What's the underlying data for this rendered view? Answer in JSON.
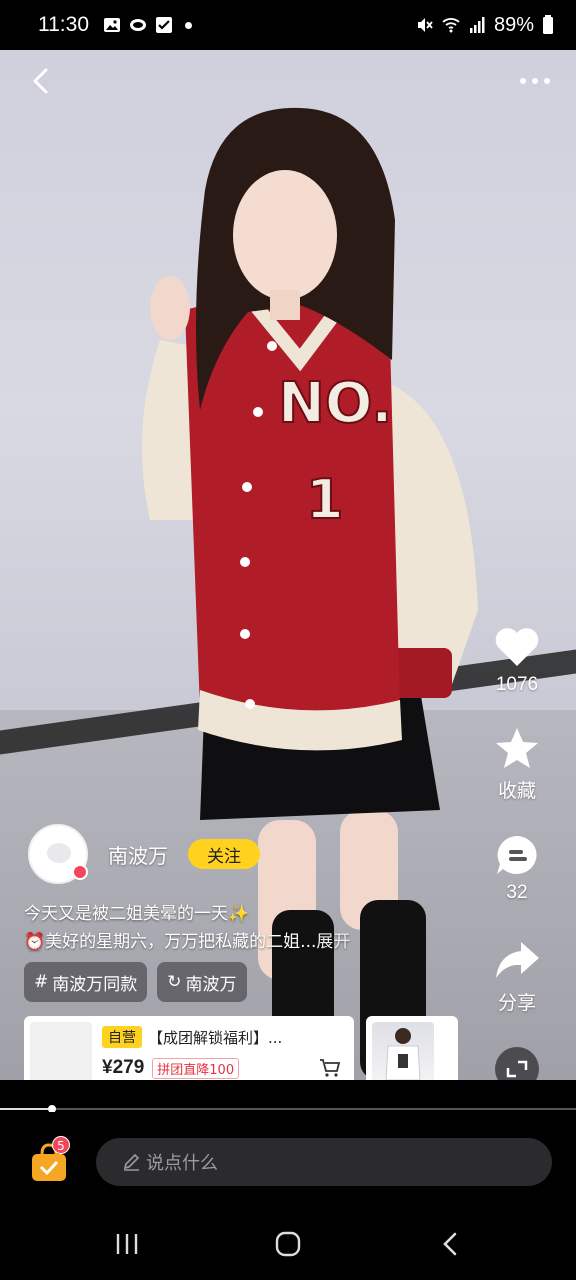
{
  "status": {
    "time": "11:30",
    "battery": "89%"
  },
  "actions": {
    "like_count": "1076",
    "favorite_label": "收藏",
    "comment_count": "32",
    "share_label": "分享"
  },
  "author": {
    "name": "南波万",
    "follow_label": "关注"
  },
  "caption": {
    "line1": "今天又是被二姐美晕的一天✨",
    "line2": "⏰美好的星期六，万万把私藏的二姐...",
    "expand": "展开"
  },
  "tags": [
    {
      "icon": "#",
      "label": "南波万同款"
    },
    {
      "icon": "↻",
      "label": "南波万"
    }
  ],
  "product": {
    "badge": "自营",
    "title": "【成团解锁福利】...",
    "price": "¥279",
    "promo": "拼团直降100"
  },
  "progress_fraction": 0.09,
  "comment_placeholder": "说点什么",
  "cart_badge": "5",
  "colors": {
    "accent": "#ffd21f",
    "badge_red": "#f3465a"
  }
}
